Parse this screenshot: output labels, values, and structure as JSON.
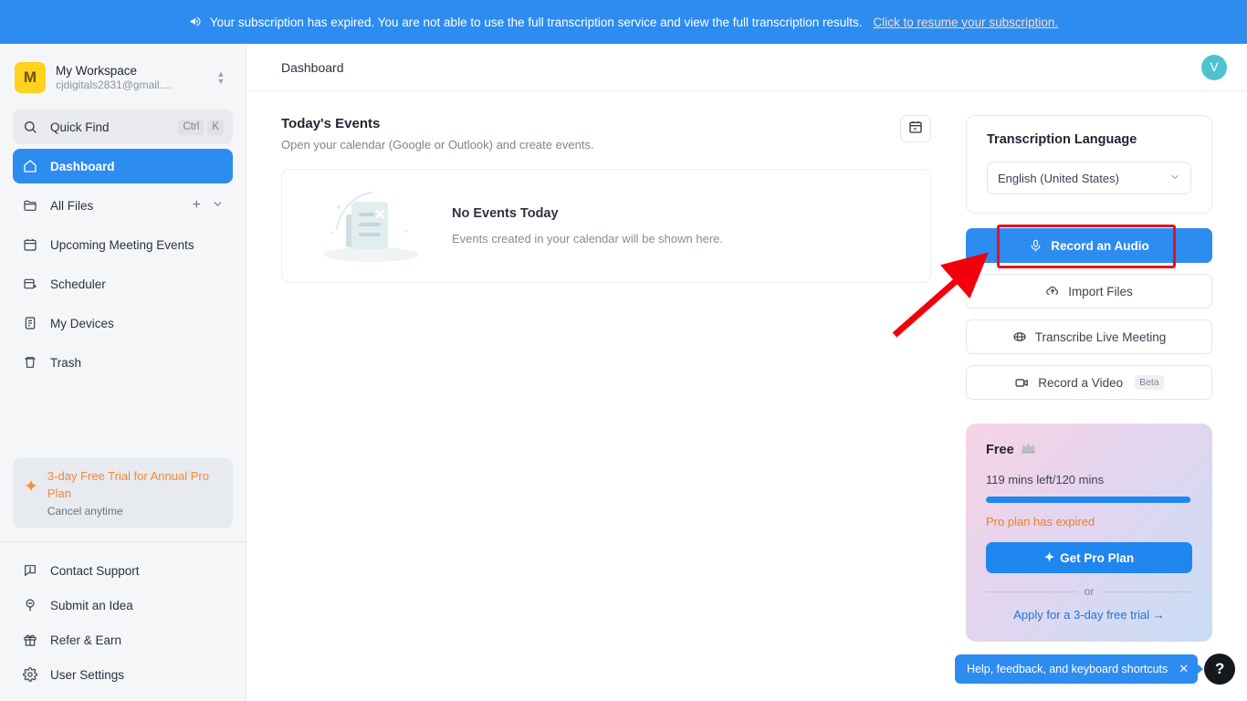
{
  "banner": {
    "icon": "megaphone-icon",
    "text": "Your subscription has expired. You are not able to use the full transcription service and view the full transcription results.",
    "link": "Click to resume your subscription.",
    "bg": "#2d8cf0",
    "link_color": "#ffd9c0"
  },
  "sidebar": {
    "workspace": {
      "avatar_letter": "M",
      "avatar_bg": "#ffd21e",
      "name": "My Workspace",
      "email": "cjdigitals2831@gmail...."
    },
    "quick_find": {
      "label": "Quick Find",
      "shortcut_keys": [
        "Ctrl",
        "K"
      ],
      "icon": "search-icon"
    },
    "items": [
      {
        "label": "Dashboard",
        "icon": "home-icon",
        "active": true
      },
      {
        "label": "All Files",
        "icon": "folder-icon",
        "active": false,
        "trailing": [
          "plus-icon",
          "chevron-down-icon"
        ]
      },
      {
        "label": "Upcoming Meeting Events",
        "icon": "calendar-icon",
        "active": false
      },
      {
        "label": "Scheduler",
        "icon": "calendar-plus-icon",
        "active": false
      },
      {
        "label": "My Devices",
        "icon": "device-icon",
        "active": false
      },
      {
        "label": "Trash",
        "icon": "trash-icon",
        "active": false
      }
    ],
    "promo": {
      "icon": "sparkle-icon",
      "title": "3-day Free Trial for Annual Pro Plan",
      "subtitle": "Cancel anytime",
      "title_color": "#f5883a"
    },
    "footer_items": [
      {
        "label": "Contact Support",
        "icon": "support-chat-icon"
      },
      {
        "label": "Submit an Idea",
        "icon": "lightbulb-icon"
      },
      {
        "label": "Refer & Earn",
        "icon": "gift-icon"
      },
      {
        "label": "User Settings",
        "icon": "gear-icon"
      }
    ]
  },
  "topbar": {
    "breadcrumb": "Dashboard",
    "avatar_letter": "V",
    "avatar_bg": "#4ec3cf"
  },
  "events": {
    "title": "Today's Events",
    "subtitle": "Open your calendar (Google or Outlook) and create events.",
    "calendar_button_icon": "calendar-icon",
    "empty_title": "No Events Today",
    "empty_subtitle": "Events created in your calendar will be shown here.",
    "empty_illustration": "empty-document-icon"
  },
  "transcription": {
    "title": "Transcription Language",
    "selected_language": "English (United States)",
    "chevron": "chevron-down-icon"
  },
  "actions": [
    {
      "label": "Record an Audio",
      "icon": "microphone-icon",
      "primary": true,
      "badge": ""
    },
    {
      "label": "Import Files",
      "icon": "upload-cloud-icon",
      "primary": false,
      "badge": ""
    },
    {
      "label": "Transcribe Live Meeting",
      "icon": "live-meeting-icon",
      "primary": false,
      "badge": ""
    },
    {
      "label": "Record a Video",
      "icon": "video-camera-icon",
      "primary": false,
      "badge": "Beta"
    }
  ],
  "plan": {
    "name": "Free",
    "badge_icon": "crown-icon",
    "minutes_text": "119 mins left/120 mins",
    "progress_percent": 99,
    "expired_text": "Pro plan has expired",
    "expired_color": "#f07f22",
    "cta_label": "Get Pro Plan",
    "cta_icon": "sparkle-icon",
    "or_label": "or",
    "trial_link": "Apply for a 3-day free trial →"
  },
  "help": {
    "pill_text": "Help, feedback, and keyboard shortcuts",
    "close_icon": "close-icon",
    "question_icon": "question-mark-icon"
  },
  "annotation": {
    "highlight_color": "#e8111c",
    "arrow_color": "#f2000c",
    "target": "Record an Audio"
  }
}
